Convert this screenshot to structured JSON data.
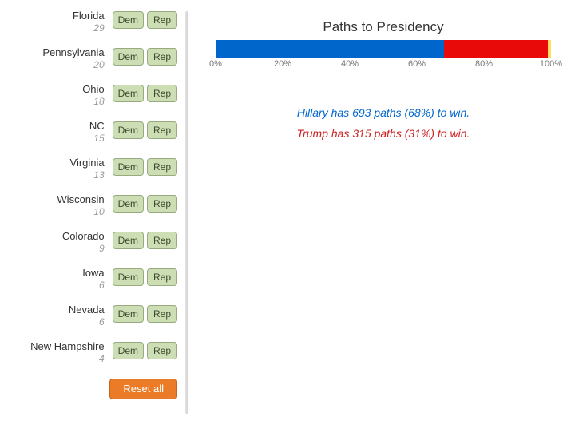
{
  "sidebar": {
    "states": [
      {
        "name": "Florida",
        "ev": "29",
        "dem_label": "Dem",
        "rep_label": "Rep"
      },
      {
        "name": "Pennsylvania",
        "ev": "20",
        "dem_label": "Dem",
        "rep_label": "Rep"
      },
      {
        "name": "Ohio",
        "ev": "18",
        "dem_label": "Dem",
        "rep_label": "Rep"
      },
      {
        "name": "NC",
        "ev": "15",
        "dem_label": "Dem",
        "rep_label": "Rep"
      },
      {
        "name": "Virginia",
        "ev": "13",
        "dem_label": "Dem",
        "rep_label": "Rep"
      },
      {
        "name": "Wisconsin",
        "ev": "10",
        "dem_label": "Dem",
        "rep_label": "Rep"
      },
      {
        "name": "Colorado",
        "ev": "9",
        "dem_label": "Dem",
        "rep_label": "Rep"
      },
      {
        "name": "Iowa",
        "ev": "6",
        "dem_label": "Dem",
        "rep_label": "Rep"
      },
      {
        "name": "Nevada",
        "ev": "6",
        "dem_label": "Dem",
        "rep_label": "Rep"
      },
      {
        "name": "New Hampshire",
        "ev": "4",
        "dem_label": "Dem",
        "rep_label": "Rep"
      }
    ],
    "reset_label": "Reset all"
  },
  "chart": {
    "title": "Paths to Presidency",
    "axis_ticks": [
      "0%",
      "20%",
      "40%",
      "60%",
      "80%",
      "100%"
    ],
    "summary_dem": "Hillary has 693 paths (68%) to win.",
    "summary_rep": "Trump has 315 paths (31%) to win."
  },
  "colors": {
    "dem": "#0066cc",
    "rep": "#e80909",
    "other": "#ffdd63",
    "pill_bg": "#cddeb4",
    "pill_border": "#98ab7e",
    "reset_bg": "#ec7b27"
  },
  "chart_data": {
    "type": "bar",
    "title": "Paths to Presidency",
    "xlabel": "",
    "ylabel": "",
    "xlim": [
      0,
      100
    ],
    "orientation": "horizontal-stacked",
    "series": [
      {
        "name": "Hillary (Dem)",
        "value": 68,
        "paths": 693
      },
      {
        "name": "Trump (Rep)",
        "value": 31,
        "paths": 315
      },
      {
        "name": "Other / tie",
        "value": 1
      }
    ],
    "axis_ticks_pct": [
      0,
      20,
      40,
      60,
      80,
      100
    ]
  }
}
